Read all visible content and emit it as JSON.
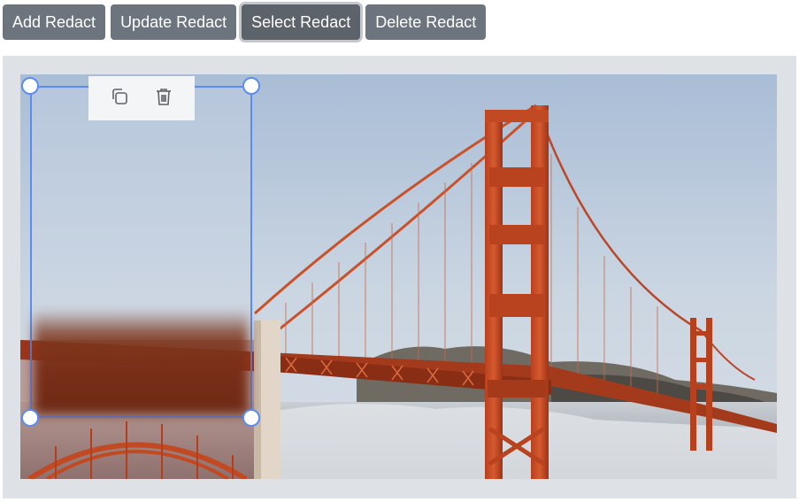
{
  "toolbar": {
    "buttons": [
      {
        "label": "Add Redact"
      },
      {
        "label": "Update Redact"
      },
      {
        "label": "Select Redact",
        "active": true
      },
      {
        "label": "Delete Redact"
      }
    ]
  },
  "redaction": {
    "actions": [
      {
        "icon": "copy-icon"
      },
      {
        "icon": "trash-icon"
      }
    ]
  },
  "colors": {
    "button": "#6c757d",
    "button_active_ring": "#c4c8cc",
    "panel_bg": "#dee2e6",
    "selection": "#5b8def"
  }
}
